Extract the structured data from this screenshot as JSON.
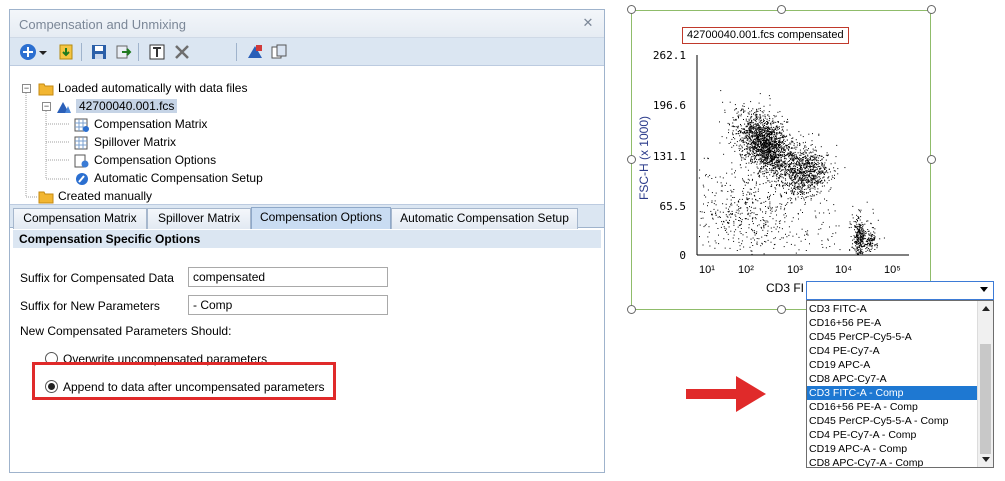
{
  "window": {
    "title": "Compensation and Unmixing",
    "close_glyph": "✕"
  },
  "toolbar": {
    "buttons": [
      "add-icon",
      "dropdown-icon",
      "import-icon",
      "save-icon",
      "export-icon",
      "rename-icon",
      "delete-icon",
      "matrix-plot-icon",
      "copy-icon"
    ]
  },
  "tree": {
    "root1": "Loaded automatically with data files",
    "file": "42700040.001.fcs",
    "children": [
      "Compensation Matrix",
      "Spillover Matrix",
      "Compensation Options",
      "Automatic Compensation Setup"
    ],
    "root2": "Created manually"
  },
  "tabs": [
    "Compensation Matrix",
    "Spillover Matrix",
    "Compensation Options",
    "Automatic Compensation Setup"
  ],
  "options": {
    "section_title": "Compensation Specific Options",
    "suffix_data_label": "Suffix for Compensated Data",
    "suffix_data_value": "compensated",
    "suffix_params_label": "Suffix for New Parameters",
    "suffix_params_value": "- Comp",
    "params_should_label": "New Compensated Parameters Should:",
    "radio_overwrite": "Overwrite uncompensated parameters",
    "radio_append": "Append to data after uncompensated parameters",
    "selected_radio": "append"
  },
  "plot": {
    "title": "42700040.001.fcs compensated",
    "ylabel": "FSC-H (x 1000)",
    "yticks": [
      "262.1",
      "196.6",
      "131.1",
      "65.5",
      "0"
    ],
    "xticks": [
      "10¹",
      "10²",
      "10³",
      "10⁴",
      "10⁵"
    ],
    "xaxis_value": "CD3 F",
    "xaxis_value_cut": "CD3 FI"
  },
  "dropdown": {
    "items": [
      "CD3 FITC-A",
      "CD16+56 PE-A",
      "CD45 PerCP-Cy5-5-A",
      "CD4 PE-Cy7-A",
      "CD19 APC-A",
      "CD8 APC-Cy7-A",
      "CD3 FITC-A - Comp",
      "CD16+56 PE-A - Comp",
      "CD45 PerCP-Cy5-5-A - Comp",
      "CD4 PE-Cy7-A - Comp",
      "CD19 APC-A - Comp",
      "CD8 APC-Cy7-A - Comp"
    ],
    "highlighted_index": 6
  },
  "colors": {
    "accent_red": "#e02a2a",
    "highlight_blue": "#1e78d2",
    "axis_label_blue": "#2a3a8a"
  }
}
